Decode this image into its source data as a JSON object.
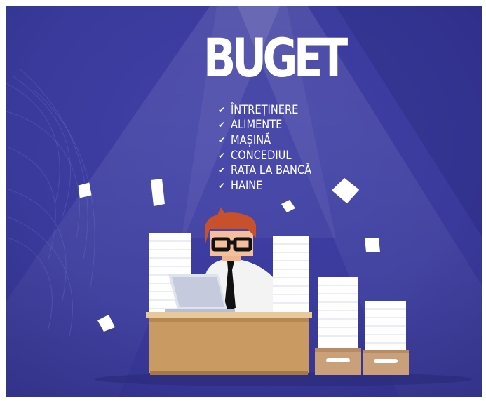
{
  "title": "BUGET",
  "checklist": [
    {
      "icon": "check-icon",
      "label": "ÎNTREȚINERE"
    },
    {
      "icon": "check-icon",
      "label": "ALIMENTE"
    },
    {
      "icon": "check-icon",
      "label": "MAȘINĂ"
    },
    {
      "icon": "check-icon",
      "label": "CONCEDIUL"
    },
    {
      "icon": "check-icon",
      "label": "RATA LA BANCĂ"
    },
    {
      "icon": "check-icon",
      "label": "HAINE"
    }
  ],
  "colors": {
    "background": "#3b3b9e",
    "accent_white": "#ffffff",
    "desk": "#c99a62",
    "hair": "#c8502a",
    "shirt": "#f3f3f3"
  }
}
